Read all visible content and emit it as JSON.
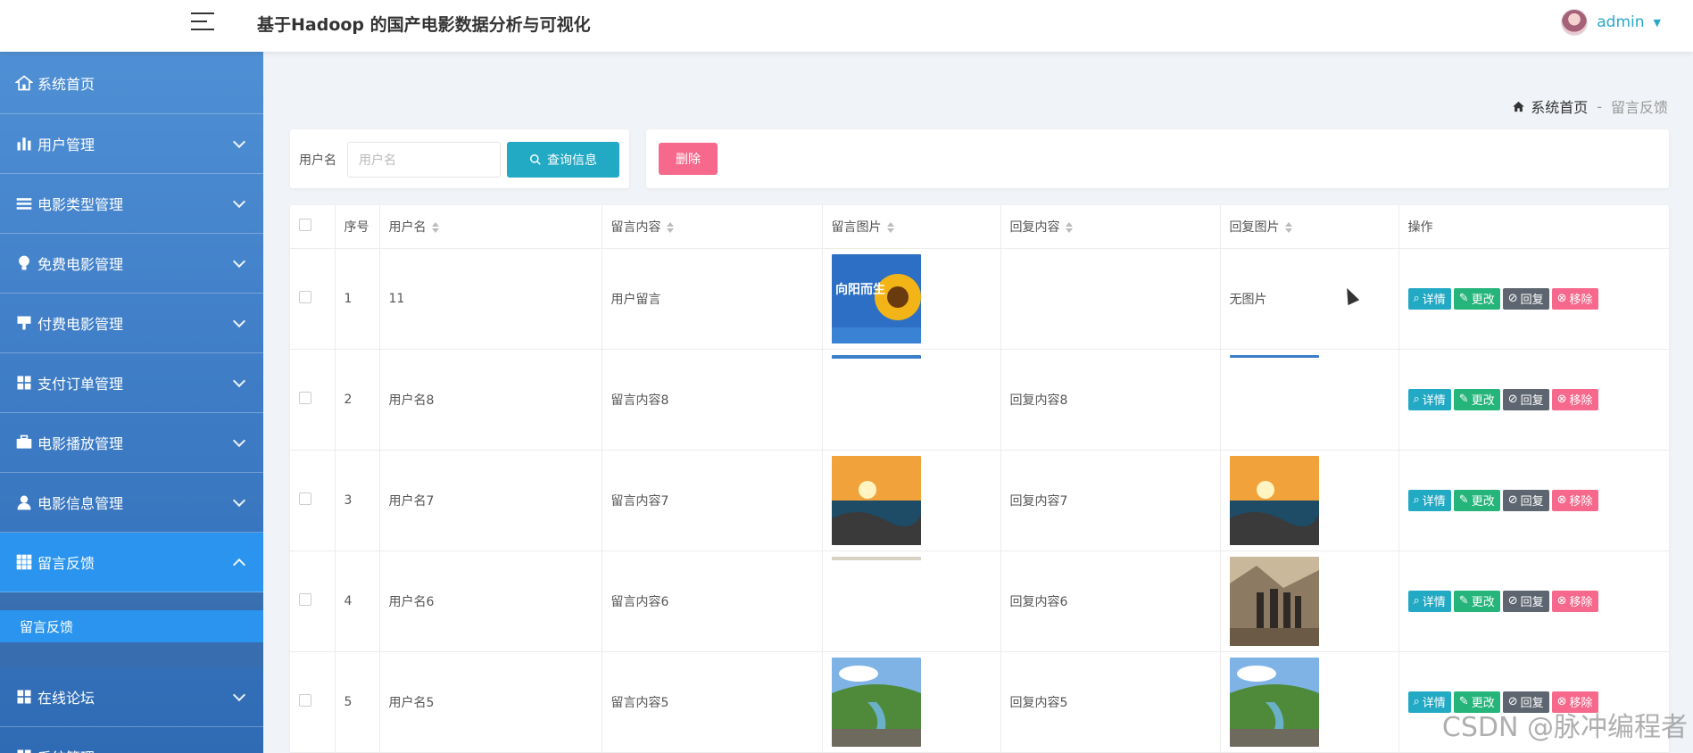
{
  "header": {
    "title": "基于Hadoop 的国产电影数据分析与可视化",
    "user_name": "admin"
  },
  "sidebar": {
    "items": [
      {
        "label": "系统首页",
        "icon": "home-icon"
      },
      {
        "label": "用户管理",
        "icon": "bar-chart-icon"
      },
      {
        "label": "电影类型管理",
        "icon": "list-icon"
      },
      {
        "label": "免费电影管理",
        "icon": "bulb-icon"
      },
      {
        "label": "付费电影管理",
        "icon": "brush-icon"
      },
      {
        "label": "支付订单管理",
        "icon": "grid-icon"
      },
      {
        "label": "电影播放管理",
        "icon": "briefcase-icon"
      },
      {
        "label": "电影信息管理",
        "icon": "user-icon"
      },
      {
        "label": "留言反馈",
        "icon": "apps-icon"
      },
      {
        "label": "在线论坛",
        "icon": "grid-icon"
      },
      {
        "label": "系统管理",
        "icon": "grid-icon"
      }
    ],
    "submenu": [
      "留言反馈"
    ]
  },
  "breadcrumb": {
    "home": "系统首页",
    "separator": "-",
    "current": "留言反馈"
  },
  "search": {
    "label": "用户名",
    "placeholder": "用户名",
    "button": "查询信息"
  },
  "actions": {
    "delete": "删除"
  },
  "table": {
    "columns": [
      "序号",
      "用户名",
      "留言内容",
      "留言图片",
      "回复内容",
      "回复图片",
      "操作"
    ],
    "rows": [
      {
        "index": "1",
        "user": "11",
        "message": "用户留言",
        "reply": "",
        "reply_image_text": "无图片"
      },
      {
        "index": "2",
        "user": "用户名8",
        "message": "留言内容8",
        "reply": "回复内容8",
        "reply_image_text": ""
      },
      {
        "index": "3",
        "user": "用户名7",
        "message": "留言内容7",
        "reply": "回复内容7",
        "reply_image_text": ""
      },
      {
        "index": "4",
        "user": "用户名6",
        "message": "留言内容6",
        "reply": "回复内容6",
        "reply_image_text": ""
      },
      {
        "index": "5",
        "user": "用户名5",
        "message": "留言内容5",
        "reply": "回复内容5",
        "reply_image_text": ""
      }
    ],
    "ops": {
      "detail": "详情",
      "edit": "更改",
      "reply": "回复",
      "remove": "移除"
    },
    "image_text": {
      "sunflower_title": "向阳而生"
    }
  },
  "watermark": "CSDN @脉冲编程者"
}
